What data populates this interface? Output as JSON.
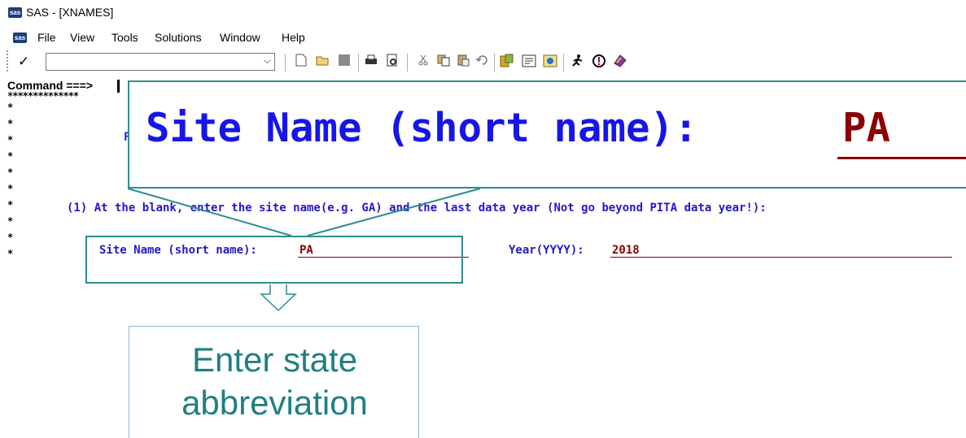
{
  "window": {
    "title": "SAS - [XNAMES]",
    "logo_text": "sas"
  },
  "menu": {
    "items": [
      "File",
      "View",
      "Tools",
      "Solutions",
      "Window",
      "Help"
    ]
  },
  "toolbar": {
    "check_label": "✓",
    "combo_value": "",
    "combo_arrow": "⌵",
    "icons": [
      "new-icon",
      "open-icon",
      "save-icon",
      "print-icon",
      "print-preview-icon",
      "cut-icon",
      "copy-icon",
      "paste-icon",
      "undo-icon",
      "explorer-icon",
      "results-icon",
      "find-icon",
      "run-icon",
      "stop-icon",
      "help-book-icon"
    ]
  },
  "editor": {
    "command_label": "Command ===>",
    "stars": "**************",
    "star_char": "*",
    "partial_char": "F",
    "instruction": "(1) At the blank, enter the site name(e.g. GA) and the last data year (Not go beyond PITA data year!):",
    "site_label": "Site Name (short name):",
    "site_value": "PA",
    "year_label": "Year(YYYY):",
    "year_value": "2018"
  },
  "zoom_callout": {
    "label": "Site Name (short name):",
    "value": "PA"
  },
  "note": {
    "line1": "Enter state",
    "line2": "abbreviation"
  },
  "colors": {
    "label_blue": "#2419c9",
    "value_red": "#8b0000",
    "callout_teal": "#2e8e8e",
    "note_text": "#1f7f82"
  }
}
